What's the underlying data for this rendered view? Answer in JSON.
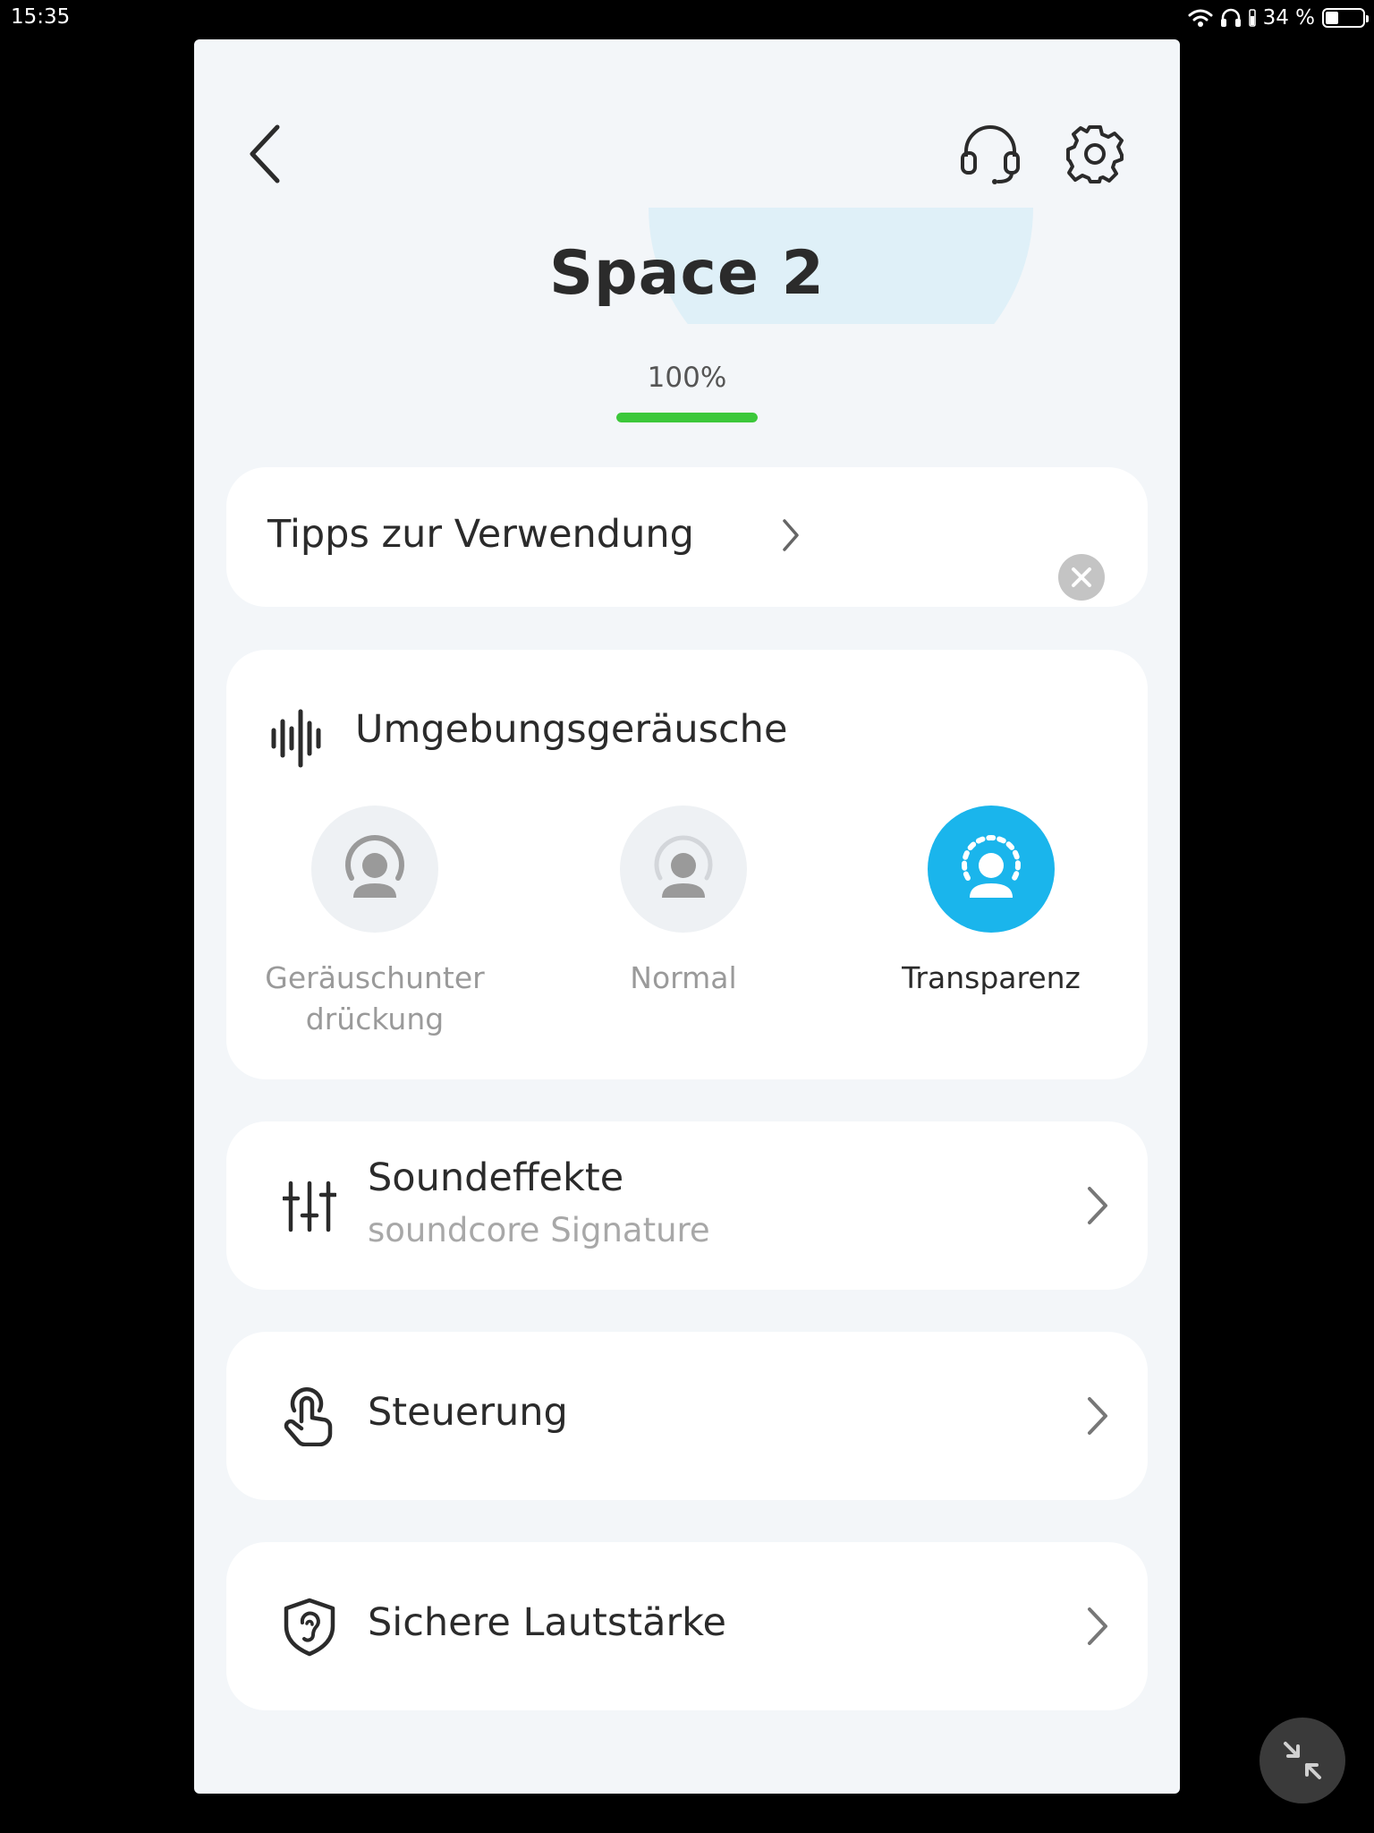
{
  "status_bar": {
    "time": "15:35",
    "battery_percent_text": "34 %",
    "battery_level": 0.34,
    "icons": [
      "wifi-icon",
      "headphones-icon",
      "battery-icon"
    ]
  },
  "header": {
    "back_icon": "chevron-left-icon",
    "support_icon": "headset-icon",
    "settings_icon": "gear-icon"
  },
  "device": {
    "name": "Space 2",
    "battery_text": "100%",
    "battery_level": 1.0,
    "battery_color": "#3cc83a"
  },
  "tips": {
    "label": "Tipps zur Verwendung",
    "close_icon": "close-icon"
  },
  "ambient": {
    "title": "Umgebungsgeräusche",
    "icon": "soundwave-icon",
    "active_color": "#1ab5ec",
    "modes": [
      {
        "label_line1": "Geräuschunter",
        "label_line2": "drückung",
        "icon": "noise-cancelling-icon",
        "active": false
      },
      {
        "label_line1": "Normal",
        "label_line2": "",
        "icon": "normal-mode-icon",
        "active": false
      },
      {
        "label_line1": "Transparenz",
        "label_line2": "",
        "icon": "transparency-icon",
        "active": true
      }
    ]
  },
  "rows": {
    "sound": {
      "title": "Soundeffekte",
      "subtitle": "soundcore Signature",
      "icon": "equalizer-icon"
    },
    "control": {
      "title": "Steuerung",
      "icon": "touch-icon"
    },
    "safe_volume": {
      "title": "Sichere Lautstärke",
      "icon": "ear-shield-icon"
    }
  },
  "floating_button": {
    "icon": "collapse-arrows-icon"
  }
}
